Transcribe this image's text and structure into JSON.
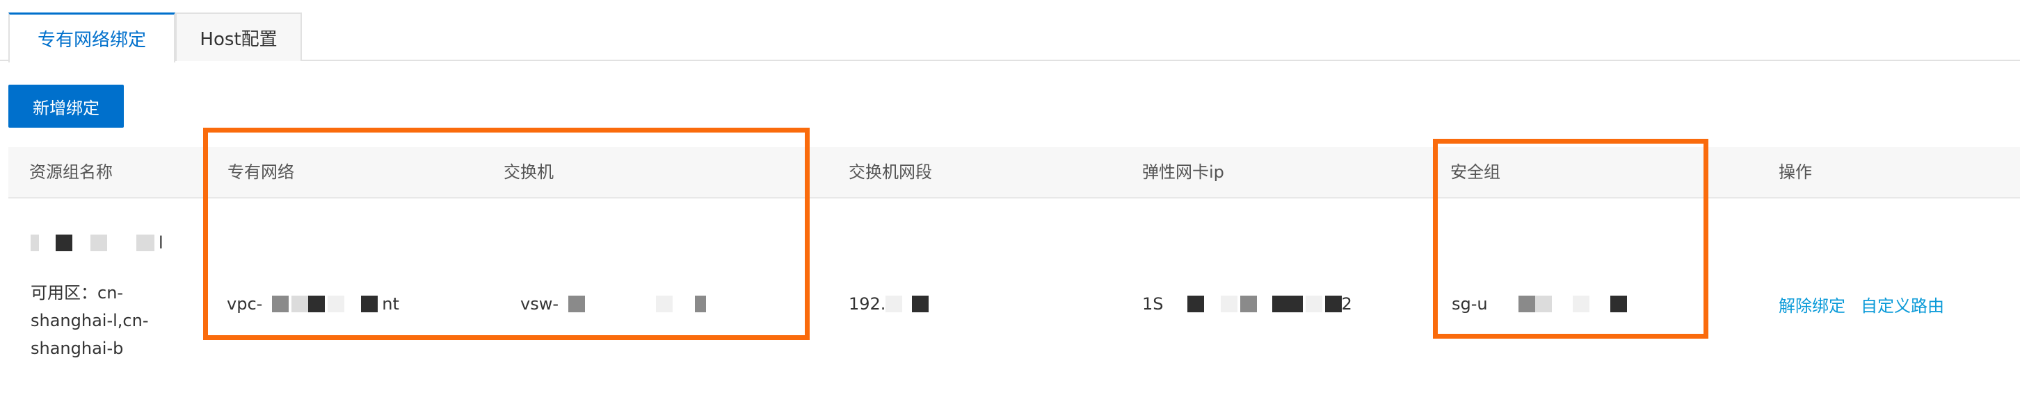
{
  "tabs": [
    {
      "label": "专有网络绑定",
      "active": true
    },
    {
      "label": "Host配置",
      "active": false
    }
  ],
  "toolbar": {
    "add_binding_label": "新增绑定"
  },
  "table": {
    "columns": {
      "resource_group": "资源组名称",
      "vpc": "专有网络",
      "vswitch": "交换机",
      "vswitch_cidr": "交换机网段",
      "eni_ip": "弹性网卡ip",
      "security_group": "安全组",
      "actions": "操作"
    },
    "rows": [
      {
        "resource_group_name_suffix": "l",
        "zone_text": "可用区：cn-\nshanghai-l,cn-\nshanghai-b",
        "zone_line1": "可用区：cn-",
        "zone_line2": "shanghai-l,cn-",
        "zone_line3": "shanghai-b",
        "vpc_prefix": "vpc-",
        "vpc_suffix": "nt",
        "vswitch_prefix": "vsw-",
        "cidr_prefix": "192.",
        "ip_prefix": "1S",
        "ip_suffix": "2",
        "security_group_prefix": "sg-u",
        "actions": {
          "unbind": "解除绑定",
          "custom_route": "自定义路由"
        }
      }
    ]
  },
  "colors": {
    "primary": "#0070cc",
    "link": "#0a9ad8",
    "highlight": "#fa6b0c"
  }
}
